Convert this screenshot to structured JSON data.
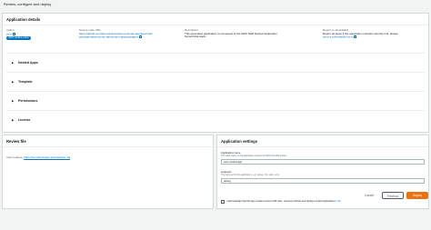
{
  "page": {
    "title": "Review, configure and deploy"
  },
  "details": {
    "title": "Application details",
    "author_label": "Author",
    "author_value": "yolo",
    "author_badge": "AWS verified author",
    "source_label": "Source code URL",
    "source_value_line1": "https://github.com/aws-samples/sam-example-app/tree/main/",
    "source_value_line2": "packages/apps/cloud-deployment-app/packaged",
    "description_label": "Description",
    "description_line1": "This serverless application is composed of the AWS SAM Nested Application",
    "description_line2": "hierarchical stack.",
    "report_label": "Report a vulnerability",
    "report_line1": "Report an issue if the application contains security risk, please",
    "report_line2": "send a vulnerability form",
    "sections": [
      {
        "caret": "▶",
        "label": "Nested Apps"
      },
      {
        "caret": "▶",
        "label": "Template"
      },
      {
        "caret": "▶",
        "label": "Permissions"
      },
      {
        "caret": "▶",
        "label": "License"
      }
    ]
  },
  "readme": {
    "title": "Review file",
    "text_prefix": "View readme:",
    "link": "https://serverlessrepo.aws/readme.md"
  },
  "settings": {
    "title": "Application settings",
    "name_label": "Application name",
    "name_hint": "The stack name of this application created via AWS CloudFormation",
    "name_value": "sam-nested-app",
    "param_label": "LogLevel",
    "param_hint": "The log level for this application, e.g. debug, info, warn, error",
    "param_value": "debug",
    "ack_text": "I acknowledge that this app creates custom IAM roles, resource policies and deploys nested applications.",
    "ack_link": "Info"
  },
  "actions": {
    "cancel": "Cancel",
    "previous": "Previous",
    "deploy": "Deploy"
  },
  "colors": {
    "link": "#0073bb",
    "primary": "#ec7211",
    "background": "#f2f3f3"
  }
}
